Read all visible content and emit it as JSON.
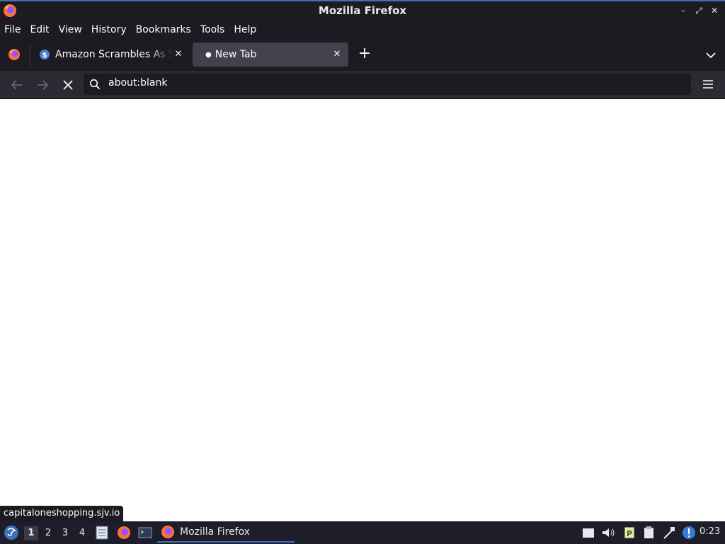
{
  "window": {
    "title": "Mozilla Firefox"
  },
  "menubar": {
    "items": [
      "File",
      "Edit",
      "View",
      "History",
      "Bookmarks",
      "Tools",
      "Help"
    ]
  },
  "tabs": [
    {
      "label": "Amazon Scrambles As Sh",
      "favicon": "capitalone-shopping-icon",
      "active": false
    },
    {
      "label": "New Tab",
      "favicon": "loading-dot",
      "active": true
    }
  ],
  "urlbar": {
    "value": "about:blank"
  },
  "status": {
    "text": "capitaloneshopping.sjv.io"
  },
  "taskbar": {
    "workspaces": [
      "1",
      "2",
      "3",
      "4"
    ],
    "active_workspace": "1",
    "task_label": "Mozilla Firefox",
    "clock": "0:23"
  },
  "colors": {
    "chrome": "#1c1b22",
    "toolbar": "#2b2a33",
    "accent": "#3f6fb5",
    "active_tab": "#42414d"
  }
}
